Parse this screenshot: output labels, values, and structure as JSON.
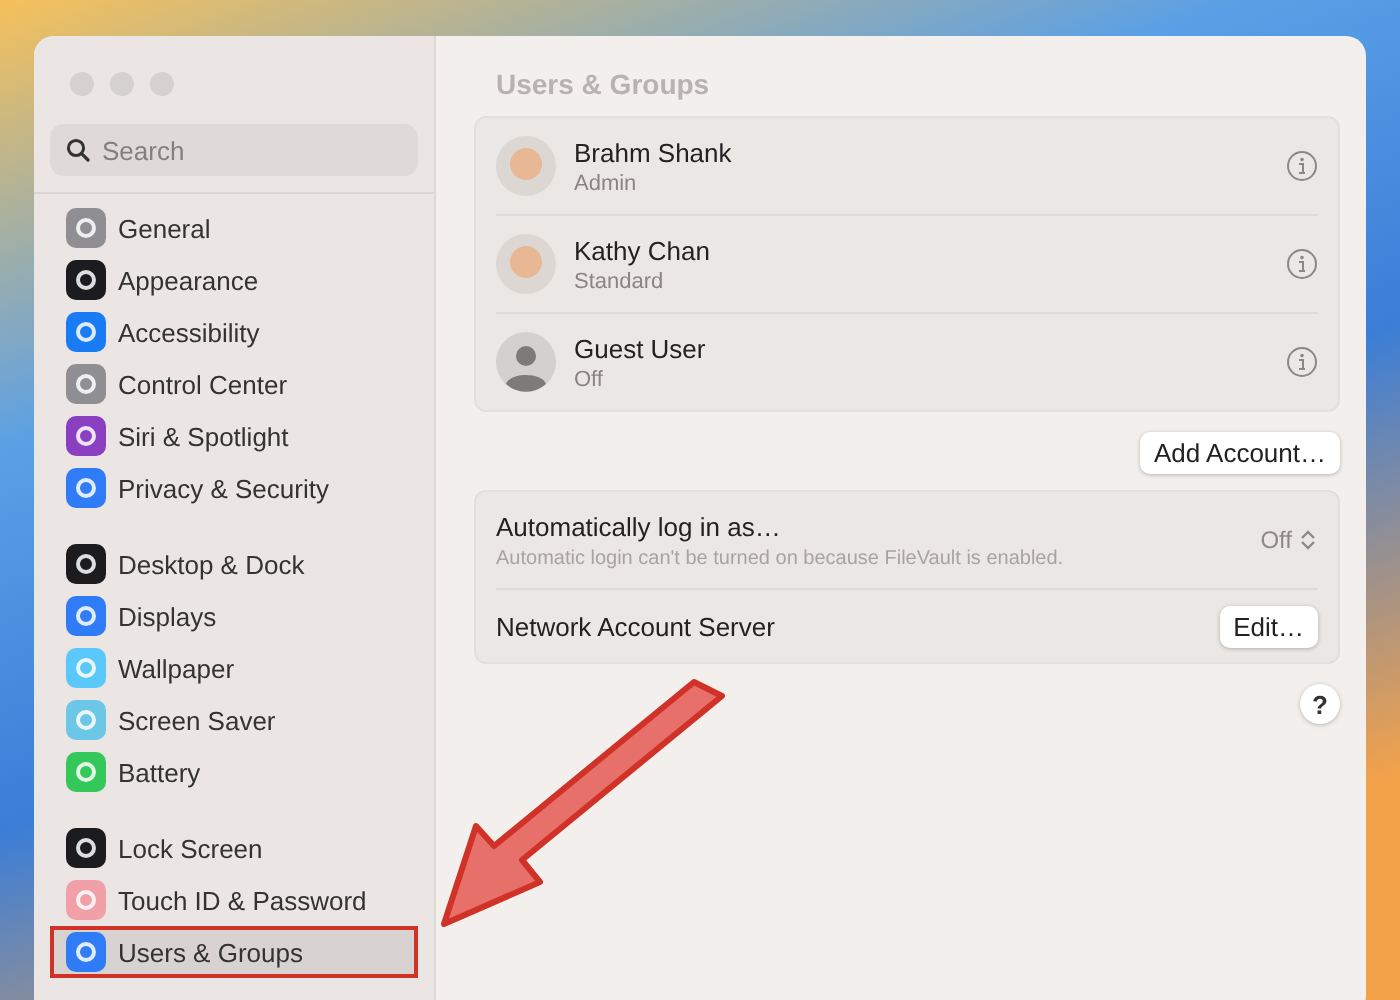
{
  "window": {
    "title": "Users & Groups"
  },
  "sidebar": {
    "search": {
      "placeholder": "Search"
    },
    "groups": [
      {
        "items": [
          {
            "label": "General",
            "color": "#8e8e93",
            "selected": false,
            "highlighted": false
          },
          {
            "label": "Appearance",
            "color": "#1c1c1e",
            "selected": false,
            "highlighted": false
          },
          {
            "label": "Accessibility",
            "color": "#1a7cf5",
            "selected": false,
            "highlighted": false
          },
          {
            "label": "Control Center",
            "color": "#8e8e93",
            "selected": false,
            "highlighted": false
          },
          {
            "label": "Siri & Spotlight",
            "color": "#8a3fc0",
            "selected": false,
            "highlighted": false
          },
          {
            "label": "Privacy & Security",
            "color": "#2f7cf6",
            "selected": false,
            "highlighted": false
          }
        ]
      },
      {
        "items": [
          {
            "label": "Desktop & Dock",
            "color": "#1c1c1e",
            "selected": false,
            "highlighted": false
          },
          {
            "label": "Displays",
            "color": "#2f7cf6",
            "selected": false,
            "highlighted": false
          },
          {
            "label": "Wallpaper",
            "color": "#5ac8fa",
            "selected": false,
            "highlighted": false
          },
          {
            "label": "Screen Saver",
            "color": "#6cc6e8",
            "selected": false,
            "highlighted": false
          },
          {
            "label": "Battery",
            "color": "#34c759",
            "selected": false,
            "highlighted": false
          }
        ]
      },
      {
        "items": [
          {
            "label": "Lock Screen",
            "color": "#1c1c1e",
            "selected": false,
            "highlighted": false
          },
          {
            "label": "Touch ID & Password",
            "color": "#f2a0a8",
            "selected": false,
            "highlighted": false
          },
          {
            "label": "Users & Groups",
            "color": "#2f7cf6",
            "selected": true,
            "highlighted": true
          }
        ]
      }
    ]
  },
  "users": [
    {
      "name": "Brahm Shank",
      "role": "Admin",
      "kind": "memoji"
    },
    {
      "name": "Kathy Chan",
      "role": "Standard",
      "kind": "memoji"
    },
    {
      "name": "Guest User",
      "role": "Off",
      "kind": "generic"
    }
  ],
  "add_account_button": "Add Account…",
  "auto_login": {
    "label": "Automatically log in as…",
    "note": "Automatic login can't be turned on because FileVault is enabled.",
    "value": "Off",
    "disabled": true
  },
  "network_server": {
    "label": "Network Account Server",
    "button": "Edit…"
  },
  "help_button": "?"
}
